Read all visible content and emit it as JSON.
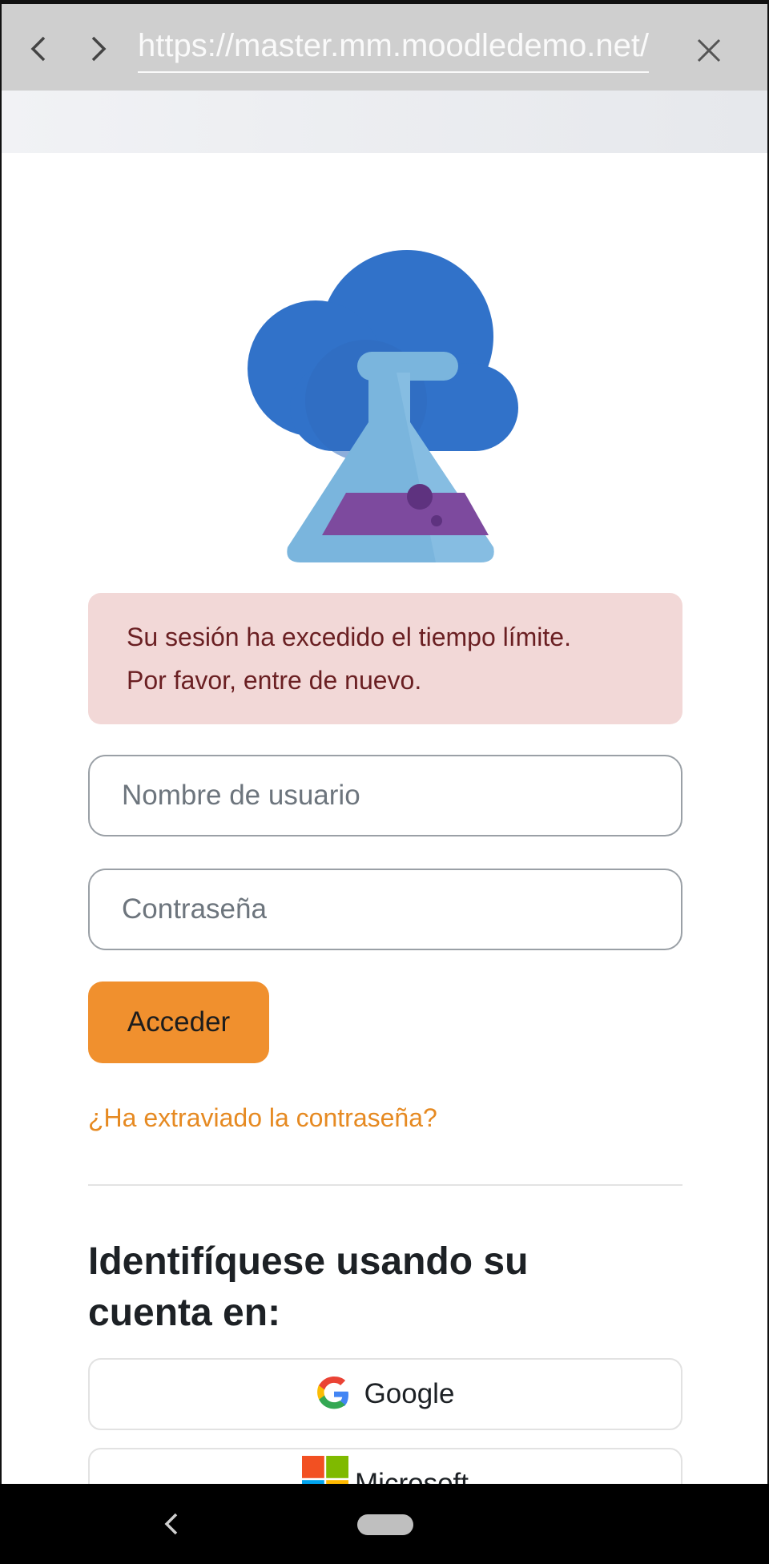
{
  "browser": {
    "url": "https://master.mm.moodledemo.net/login/index.php",
    "back_icon": "chevron-left-icon",
    "forward_icon": "chevron-right-icon",
    "close_icon": "close-icon"
  },
  "logo": {
    "icon": "cloud-flask-icon"
  },
  "alert": {
    "line1": "Su sesión ha excedido el tiempo límite.",
    "line2": "Por favor, entre de nuevo."
  },
  "form": {
    "username_placeholder": "Nombre de usuario",
    "password_placeholder": "Contraseña",
    "login_label": "Acceder",
    "forgot_link": "¿Ha extraviado la contraseña?"
  },
  "identity": {
    "heading_line1": "Identifíquese usando su",
    "heading_line2": "cuenta en:",
    "providers": [
      {
        "label": "Google",
        "icon": "google-icon"
      },
      {
        "label": "Microsoft",
        "icon": "microsoft-icon"
      }
    ]
  },
  "colors": {
    "accent": "#f0902e",
    "link": "#e68a22",
    "alert_bg": "#f2d8d7",
    "alert_text": "#6a1f22",
    "cloud": "#3172c9",
    "flask": "#7ab5dd",
    "liquid": "#7d4a9e"
  }
}
